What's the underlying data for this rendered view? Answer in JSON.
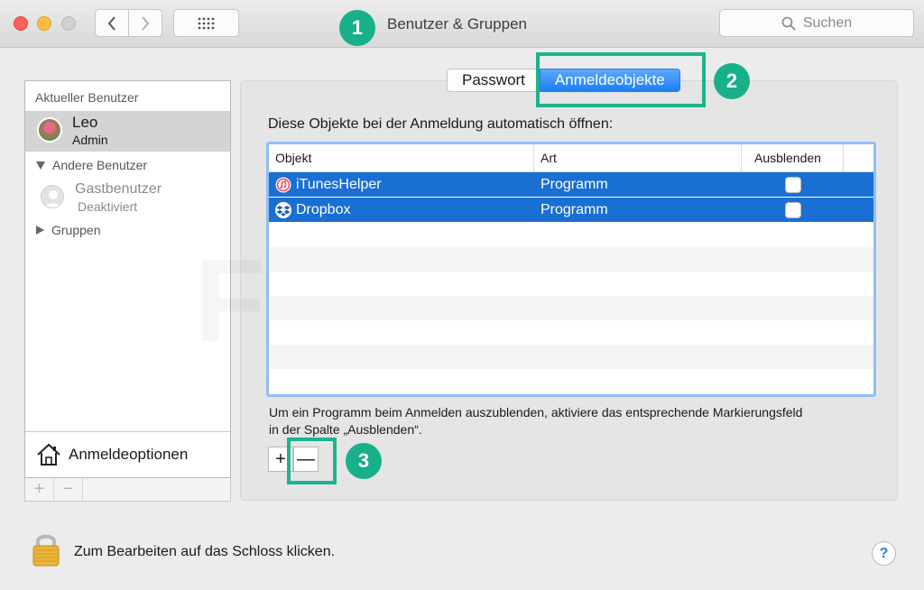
{
  "window": {
    "title": "Benutzer & Gruppen"
  },
  "search": {
    "placeholder": "Suchen"
  },
  "annotations": [
    "1",
    "2",
    "3"
  ],
  "sidebar": {
    "current_header": "Aktueller Benutzer",
    "current_user": {
      "name": "Leo",
      "role": "Admin"
    },
    "other_header": "Andere Benutzer",
    "guest": {
      "name": "Gastbenutzer",
      "state": "Deaktiviert"
    },
    "groups_header": "Gruppen",
    "login_options": "Anmeldeoptionen",
    "add_label": "+",
    "remove_label": "−"
  },
  "tabs": {
    "password": "Passwort",
    "login_items": "Anmeldeobjekte"
  },
  "main": {
    "intro": "Diese Objekte bei der Anmeldung automatisch öffnen:",
    "columns": {
      "item": "Objekt",
      "kind": "Art",
      "hide": "Ausblenden"
    },
    "rows": [
      {
        "name": "iTunesHelper",
        "kind": "Programm",
        "icon": "itunes-icon",
        "hidden": false
      },
      {
        "name": "Dropbox",
        "kind": "Programm",
        "icon": "dropbox-icon",
        "hidden": false
      }
    ],
    "hint": "Um ein Programm beim Anmelden auszublenden, aktiviere das entsprechende Markierungsfeld in der Spalte „Ausblenden“.",
    "add_label": "+",
    "remove_label": "—"
  },
  "footer": {
    "lock_text": "Zum Bearbeiten auf das Schloss klicken.",
    "help_label": "?"
  },
  "watermark": "FonePaw",
  "colors": {
    "accent": "#1a7ff5",
    "selection": "#1a6fd3",
    "annotation": "#18b08a"
  }
}
